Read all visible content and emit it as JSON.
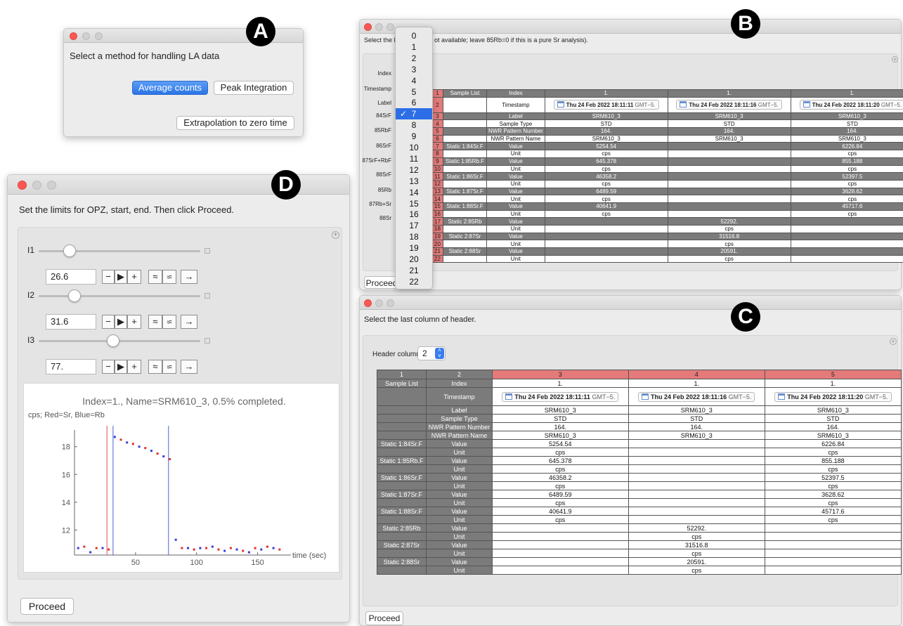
{
  "labels": {
    "a": "A",
    "b": "B",
    "c": "C",
    "d": "D"
  },
  "winA": {
    "prompt": "Select a method for handling LA data",
    "btn_average": "Average counts",
    "btn_peak": "Peak Integration",
    "btn_extrap": "Extrapolation to zero time"
  },
  "winB": {
    "prompt_left": "Select the Rb",
    "prompt_right": "ot available; leave 85Rb=0 if this is a pure Sr analysis).",
    "side_labels": [
      "Index",
      "Timestamp",
      "Label",
      "84SrF",
      "85RbF",
      "86SrF",
      "87SrF+RbF",
      "88SrF",
      "85Rb",
      "87Rb+Sr",
      "88Sr"
    ],
    "dropdown_items": [
      "0",
      "1",
      "2",
      "3",
      "4",
      "5",
      "6",
      "7",
      "8",
      "9",
      "10",
      "11",
      "12",
      "13",
      "14",
      "15",
      "16",
      "17",
      "18",
      "19",
      "20",
      "21",
      "22"
    ],
    "dropdown_selected": "7",
    "checkmark": "✓",
    "proceed": "Proceed"
  },
  "table": {
    "col_headers": [
      "1",
      "2",
      "3",
      "4",
      "5"
    ],
    "rows": [
      [
        "Sample List",
        "Index",
        "1.",
        "1.",
        "1."
      ],
      [
        "",
        "Timestamp",
        "TS",
        "TS",
        "TS"
      ],
      [
        "",
        "Label",
        "SRM610_3",
        "SRM610_3",
        "SRM610_3"
      ],
      [
        "",
        "Sample Type",
        "STD",
        "STD",
        "STD"
      ],
      [
        "",
        "NWR Pattern Number",
        "164.",
        "164.",
        "164."
      ],
      [
        "",
        "NWR Pattern Name",
        "SRM610_3",
        "SRM610_3",
        "SRM610_3"
      ],
      [
        "Static 1:84Sr.F",
        "Value",
        "5254.54",
        "",
        "6226.84"
      ],
      [
        "",
        "Unit",
        "cps",
        "",
        "cps"
      ],
      [
        "Static 1:85Rb.F",
        "Value",
        "645.378",
        "",
        "855.188"
      ],
      [
        "",
        "Unit",
        "cps",
        "",
        "cps"
      ],
      [
        "Static 1:86Sr.F",
        "Value",
        "46358.2",
        "",
        "52397.5"
      ],
      [
        "",
        "Unit",
        "cps",
        "",
        "cps"
      ],
      [
        "Static 1:87Sr.F",
        "Value",
        "6489.59",
        "",
        "3628.62"
      ],
      [
        "",
        "Unit",
        "cps",
        "",
        "cps"
      ],
      [
        "Static 1:88Sr.F",
        "Value",
        "40641.9",
        "",
        "45717.6"
      ],
      [
        "",
        "Unit",
        "cps",
        "",
        "cps"
      ],
      [
        "Static 2:85Rb",
        "Value",
        "",
        "52292.",
        ""
      ],
      [
        "",
        "Unit",
        "",
        "cps",
        ""
      ],
      [
        "Static 2:87Sr",
        "Value",
        "",
        "31516.8",
        ""
      ],
      [
        "",
        "Unit",
        "",
        "cps",
        ""
      ],
      [
        "Static 2:88Sr",
        "Value",
        "",
        "20591.",
        ""
      ],
      [
        "",
        "Unit",
        "",
        "cps",
        ""
      ]
    ],
    "timestamps": [
      "Thu 24 Feb 2022 18:11:11",
      "Thu 24 Feb 2022 18:11:16",
      "Thu 24 Feb 2022 18:11:20"
    ],
    "gmt": "GMT−5.",
    "row_numbers": [
      "1",
      "2",
      "3",
      "4",
      "5",
      "6",
      "7",
      "8",
      "9",
      "10",
      "11",
      "12",
      "13",
      "14",
      "15",
      "16",
      "17",
      "18",
      "19",
      "20",
      "21",
      "22"
    ]
  },
  "winC": {
    "prompt": "Select the last column of header.",
    "header_columns_label": "Header columns",
    "header_columns_value": "2",
    "proceed": "Proceed"
  },
  "winD": {
    "prompt": "Set the limits for OPZ, start, end. Then click Proceed.",
    "sliders": [
      {
        "label": "I1",
        "value": "26.6",
        "fraction": 0.19
      },
      {
        "label": "I2",
        "value": "31.6",
        "fraction": 0.22
      },
      {
        "label": "I3",
        "value": "77.",
        "fraction": 0.46
      }
    ],
    "ctl_minus": "−",
    "ctl_play": "▶",
    "ctl_plus": "+",
    "ctl_up": "≈",
    "ctl_down": "≈",
    "ctl_right": "→",
    "plot_title": "Index=1., Name=SRM610_3, 0.5% completed.",
    "plot_ylabel": "cps; Red=Sr, Blue=Rb",
    "plot_xlabel": "time (sec)",
    "proceed": "Proceed"
  },
  "chart_data": {
    "type": "scatter",
    "title": "Index=1., Name=SRM610_3, 0.5% completed.",
    "xlabel": "time (sec)",
    "ylabel": "cps; Red=Sr, Blue=Rb",
    "xlim": [
      0,
      175
    ],
    "ylim": [
      10.2,
      19.2
    ],
    "xticks": [
      50,
      100,
      150
    ],
    "yticks": [
      12,
      14,
      16,
      18
    ],
    "vlines": [
      {
        "x": 26.6,
        "color": "#e05050"
      },
      {
        "x": 31.6,
        "color": "#5060d8"
      },
      {
        "x": 77,
        "color": "#5060d8"
      }
    ],
    "series": [
      {
        "color": "#3a3ad8",
        "points": [
          [
            3,
            10.7
          ],
          [
            13,
            10.4
          ],
          [
            23,
            10.7
          ],
          [
            33,
            18.7
          ],
          [
            43,
            18.3
          ],
          [
            53,
            18.0
          ],
          [
            63,
            17.7
          ],
          [
            73,
            17.3
          ],
          [
            83,
            11.3
          ],
          [
            93,
            10.7
          ],
          [
            103,
            10.7
          ],
          [
            113,
            10.8
          ],
          [
            123,
            10.5
          ],
          [
            133,
            10.6
          ],
          [
            143,
            10.4
          ],
          [
            153,
            10.6
          ],
          [
            163,
            10.7
          ]
        ]
      },
      {
        "color": "#e03030",
        "points": [
          [
            8,
            10.8
          ],
          [
            18,
            10.7
          ],
          [
            28,
            10.6
          ],
          [
            38,
            18.5
          ],
          [
            48,
            18.2
          ],
          [
            58,
            17.9
          ],
          [
            68,
            17.5
          ],
          [
            78,
            17.1
          ],
          [
            88,
            10.7
          ],
          [
            98,
            10.6
          ],
          [
            108,
            10.7
          ],
          [
            118,
            10.6
          ],
          [
            128,
            10.7
          ],
          [
            138,
            10.5
          ],
          [
            148,
            10.7
          ],
          [
            158,
            10.8
          ],
          [
            168,
            10.6
          ]
        ]
      }
    ]
  }
}
